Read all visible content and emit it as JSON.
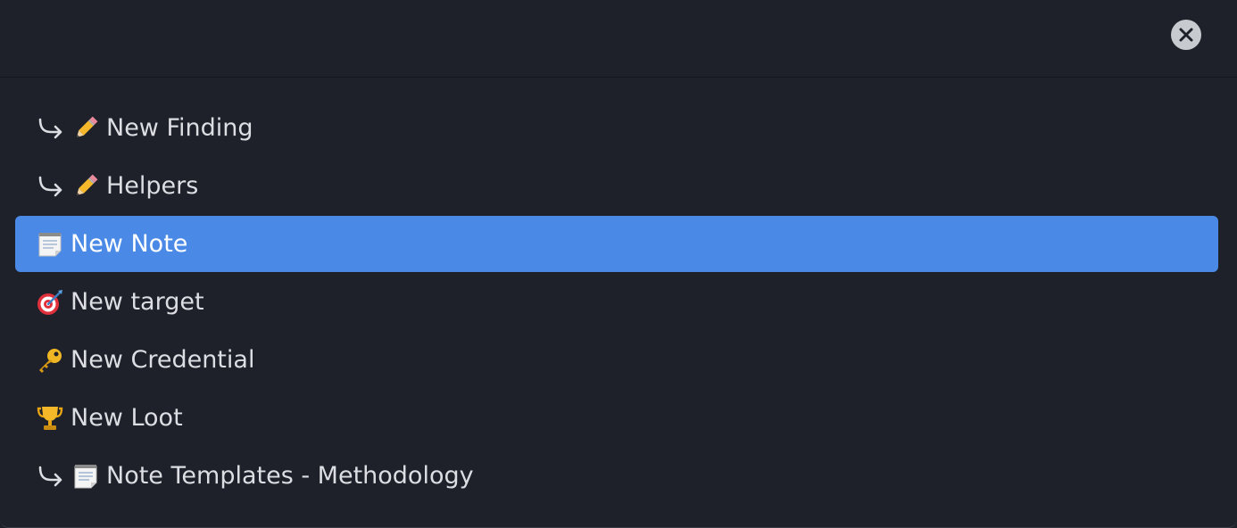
{
  "header": {
    "close_icon": "close-icon"
  },
  "suggestions": [
    {
      "label": "New Finding",
      "nested": true,
      "icon": "pencil-icon",
      "selected": false
    },
    {
      "label": "Helpers",
      "nested": true,
      "icon": "pencil-icon",
      "selected": false
    },
    {
      "label": "New Note",
      "nested": false,
      "icon": "notepad-icon",
      "selected": true
    },
    {
      "label": "New target",
      "nested": false,
      "icon": "target-icon",
      "selected": false
    },
    {
      "label": "New Credential",
      "nested": false,
      "icon": "key-icon",
      "selected": false
    },
    {
      "label": "New Loot",
      "nested": false,
      "icon": "trophy-icon",
      "selected": false
    },
    {
      "label": "Note Templates - Methodology",
      "nested": true,
      "icon": "notepad-icon",
      "selected": false
    }
  ],
  "colors": {
    "background": "#1e2129",
    "selected": "#4a8ae6",
    "text": "#dcdee3"
  }
}
